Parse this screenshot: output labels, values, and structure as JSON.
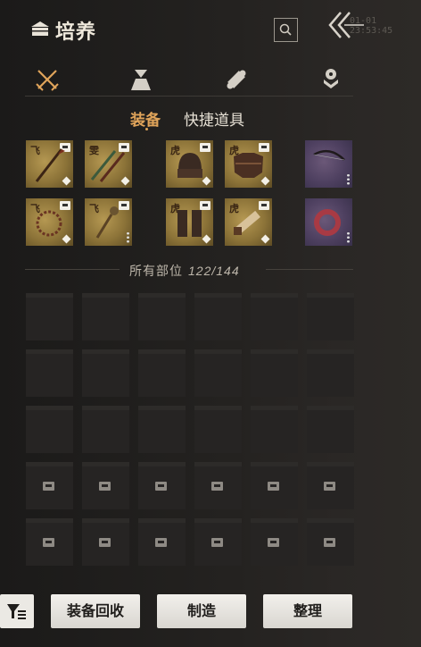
{
  "header": {
    "title": "培养",
    "title_icon": "chest-icon",
    "search_icon": "search-icon",
    "back_icon": "double-chevron-back-icon",
    "clock": "01-01 23:53:45"
  },
  "category_tabs": [
    {
      "name": "weapons",
      "icon": "crossed-swords-icon",
      "active": true
    },
    {
      "name": "bundle",
      "icon": "bundle-icon",
      "active": false
    },
    {
      "name": "scroll",
      "icon": "scroll-icon",
      "active": false
    },
    {
      "name": "badge",
      "icon": "medal-icon",
      "active": false
    }
  ],
  "sub_tabs": {
    "active": "装备",
    "other": "快捷道具"
  },
  "equipped": [
    {
      "slot": "weapon-1",
      "char": "飞",
      "rarity": "gold",
      "item": "spear"
    },
    {
      "slot": "weapon-2",
      "char": "雯",
      "rarity": "gold",
      "item": "twin-blades"
    },
    {
      "slot": "armor-head",
      "char": "虎",
      "rarity": "gold",
      "item": "helmet"
    },
    {
      "slot": "armor-body",
      "char": "虎",
      "rarity": "gold",
      "item": "chest-armor"
    },
    {
      "slot": "ranged",
      "char": "",
      "rarity": "purple",
      "item": "bow"
    },
    {
      "slot": "weapon-3",
      "char": "飞",
      "rarity": "gold",
      "item": "whip-chain"
    },
    {
      "slot": "weapon-4",
      "char": "飞",
      "rarity": "gold",
      "item": "flail"
    },
    {
      "slot": "armor-legs",
      "char": "虎",
      "rarity": "gold",
      "item": "leg-guards"
    },
    {
      "slot": "armor-arms",
      "char": "虎",
      "rarity": "gold",
      "item": "bracers"
    },
    {
      "slot": "accessory",
      "char": "",
      "rarity": "purple",
      "item": "ring"
    }
  ],
  "inventory": {
    "label": "所有部位",
    "count": "122/144",
    "used": 122,
    "capacity": 144
  },
  "buttons": {
    "filter_icon": "filter-icon",
    "recycle": "装备回收",
    "craft": "制造",
    "sort": "整理"
  },
  "colors": {
    "accent": "#e0a45a",
    "gold_rarity": "#a88c4a",
    "purple_rarity": "#54446a"
  }
}
